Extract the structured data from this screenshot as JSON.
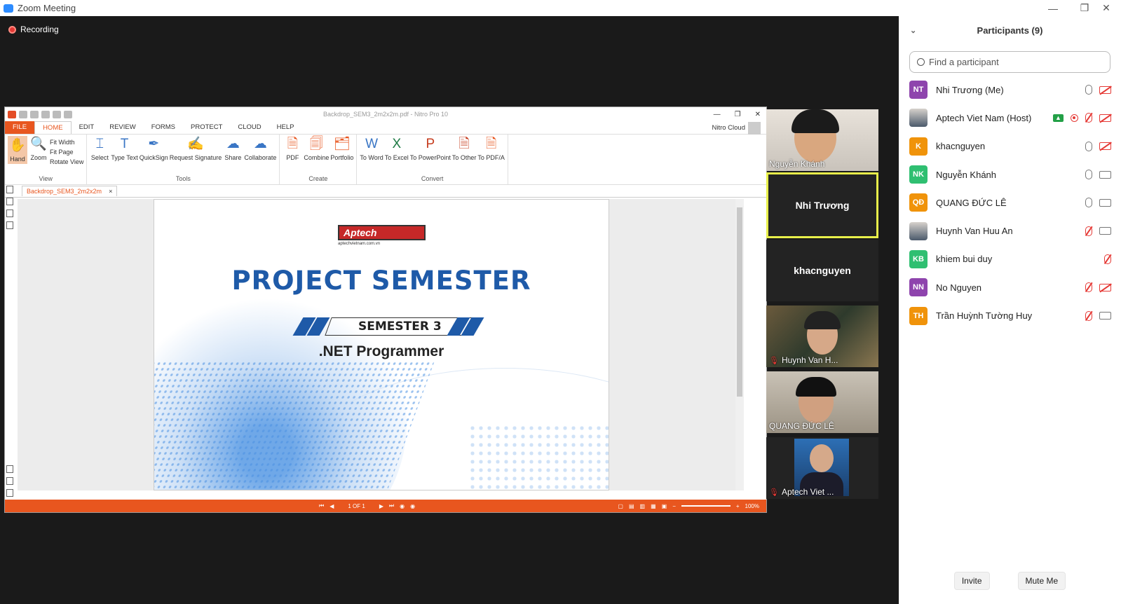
{
  "window": {
    "title": "Zoom Meeting",
    "minimize": "—",
    "maximize": "❐",
    "close": "✕"
  },
  "recording": {
    "label": "Recording"
  },
  "nitro": {
    "title": "Backdrop_SEM3_2m2x2m.pdf - Nitro Pro 10",
    "tabs": [
      "FILE",
      "HOME",
      "EDIT",
      "REVIEW",
      "FORMS",
      "PROTECT",
      "CLOUD",
      "HELP"
    ],
    "cloud_label": "Nitro Cloud",
    "groups": {
      "view": {
        "label": "View",
        "hand": "Hand",
        "zoom": "Zoom",
        "fit_width": "Fit Width",
        "fit_page": "Fit Page",
        "rotate_view": "Rotate View"
      },
      "tools": {
        "label": "Tools",
        "select": "Select",
        "type_text": "Type Text",
        "quicksign": "QuickSign",
        "request_signature": "Request Signature",
        "share": "Share",
        "collaborate": "Collaborate"
      },
      "create": {
        "label": "Create",
        "pdf": "PDF",
        "combine": "Combine",
        "portfolio": "Portfolio"
      },
      "convert": {
        "label": "Convert",
        "to_word": "To Word",
        "to_excel": "To Excel",
        "to_powerpoint": "To PowerPoint",
        "to_other": "To Other",
        "to_pdfa": "To PDF/A"
      }
    },
    "doc_tab": "Backdrop_SEM3_2m2x2m",
    "page": {
      "logo": "Aptech",
      "logo_site": "aptechvietnam.com.vn",
      "title": "PROJECT SEMESTER",
      "semester": "SEMESTER 3",
      "course": ".NET Programmer"
    },
    "status": {
      "page": "1 OF 1",
      "zoom": "100%"
    }
  },
  "videos": [
    {
      "name": "Nguyễn Khánh",
      "muted": false
    },
    {
      "name": "Nhi Trương",
      "active": true
    },
    {
      "name": "khacnguyen"
    },
    {
      "name": "Huynh Van H...",
      "muted": true
    },
    {
      "name": "QUANG ĐỨC LÊ",
      "muted": false
    },
    {
      "name": "Aptech Viet ...",
      "muted": true
    }
  ],
  "participants": {
    "title": "Participants (9)",
    "search_placeholder": "Find a participant",
    "list": [
      {
        "initials": "NT",
        "color": "#8e44ad",
        "name": "Nhi Trương (Me)"
      },
      {
        "initials": "",
        "color": "",
        "name": "Aptech Viet Nam (Host)"
      },
      {
        "initials": "K",
        "color": "#f0930a",
        "name": "khacnguyen"
      },
      {
        "initials": "NK",
        "color": "#2fbf71",
        "name": "Nguyễn Khánh"
      },
      {
        "initials": "QĐ",
        "color": "#f0930a",
        "name": "QUANG ĐỨC LÊ"
      },
      {
        "initials": "",
        "color": "",
        "name": "Huynh Van Huu An"
      },
      {
        "initials": "KB",
        "color": "#2fbf71",
        "name": "khiem bui duy"
      },
      {
        "initials": "NN",
        "color": "#8e44ad",
        "name": "No Nguyen"
      },
      {
        "initials": "TH",
        "color": "#f0930a",
        "name": "Trần Huỳnh Tường Huy"
      }
    ],
    "invite": "Invite",
    "mute_me": "Mute Me"
  }
}
